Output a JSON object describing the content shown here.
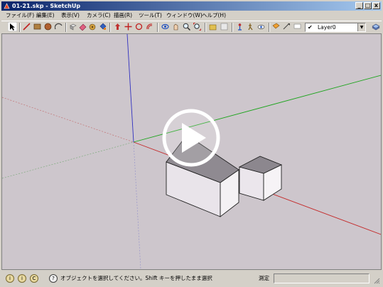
{
  "window": {
    "title": "01-21.skp - SketchUp"
  },
  "title_buttons": {
    "minimize": "_",
    "maximize": "□",
    "close": "x"
  },
  "menu": [
    {
      "label": "ファイル(F)"
    },
    {
      "label": "編集(E)"
    },
    {
      "label": "表示(V)"
    },
    {
      "label": "カメラ(C)"
    },
    {
      "label": "描画(R)"
    },
    {
      "label": "ツール(T)"
    },
    {
      "label": "ウィンドウ(W)"
    },
    {
      "label": "ヘルプ(H)"
    }
  ],
  "layer": {
    "check": "✔",
    "selected": "Layer0"
  },
  "status": {
    "hint": "オブジェクトを選択してください。Shift キーを押したまま選択",
    "measure_label": "測定",
    "icons": [
      "i",
      "i",
      "C"
    ],
    "help_icon": "?"
  },
  "axes_colors": {
    "red": "#c42a2a",
    "green": "#1aa41a",
    "blue": "#3030c0"
  },
  "video_overlay": {
    "icon": "play-icon"
  }
}
